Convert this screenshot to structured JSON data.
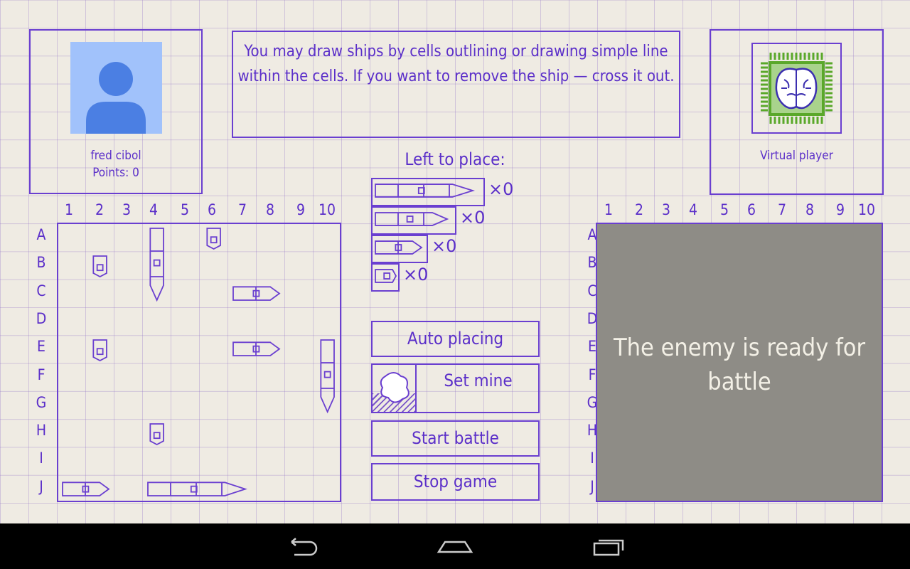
{
  "player": {
    "name": "fred cibol",
    "points": "Points: 0",
    "avatar_color": "#a1c2fb"
  },
  "message": "You may draw ships by cells outlining or drawing simple line within the cells. If you want to remove the ship — cross it out.",
  "opponent": {
    "name": "Virtual player",
    "icon": "brain-chip-icon"
  },
  "left_to_place": {
    "title": "Left to place:",
    "items": [
      {
        "size": 4,
        "count": "×0"
      },
      {
        "size": 3,
        "count": "×0"
      },
      {
        "size": 2,
        "count": "×0"
      },
      {
        "size": 1,
        "count": "×0"
      }
    ]
  },
  "columns": [
    "1",
    "2",
    "3",
    "4",
    "5",
    "6",
    "7",
    "8",
    "9",
    "10"
  ],
  "rows": [
    "A",
    "B",
    "C",
    "D",
    "E",
    "F",
    "G",
    "H",
    "I",
    "J"
  ],
  "ships": [
    {
      "row": "A",
      "col": 4,
      "size": 3,
      "dir": "v"
    },
    {
      "row": "A",
      "col": 6,
      "size": 1,
      "dir": "v"
    },
    {
      "row": "B",
      "col": 2,
      "size": 1,
      "dir": "v"
    },
    {
      "row": "C",
      "col": 7,
      "size": 2,
      "dir": "h"
    },
    {
      "row": "E",
      "col": 2,
      "size": 1,
      "dir": "v"
    },
    {
      "row": "E",
      "col": 7,
      "size": 2,
      "dir": "h"
    },
    {
      "row": "E",
      "col": 10,
      "size": 3,
      "dir": "v"
    },
    {
      "row": "H",
      "col": 4,
      "size": 1,
      "dir": "v"
    },
    {
      "row": "J",
      "col": 1,
      "size": 2,
      "dir": "h"
    },
    {
      "row": "J",
      "col": 4,
      "size": 4,
      "dir": "h"
    }
  ],
  "buttons": {
    "auto": "Auto placing",
    "mine": "Set mine",
    "start": "Start battle",
    "stop": "Stop game"
  },
  "enemy": {
    "status": "The enemy is ready for battle"
  },
  "colors": {
    "ink": "#6a3fd0",
    "enemy_board": "#8e8c86",
    "chip": "#5aa82a"
  }
}
